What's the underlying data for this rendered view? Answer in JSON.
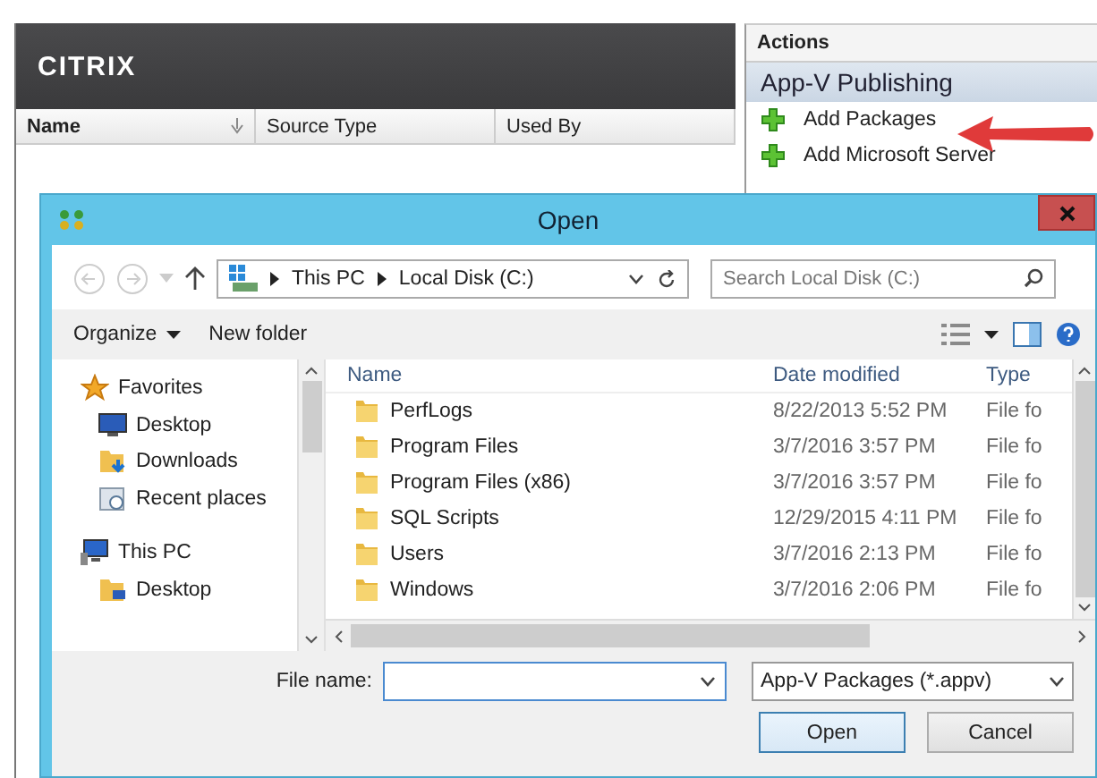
{
  "console": {
    "logo": "CITRIX",
    "columns": [
      {
        "label": "Name",
        "sorted": true
      },
      {
        "label": "Source Type",
        "sorted": false
      },
      {
        "label": "Used By",
        "sorted": false
      }
    ]
  },
  "actions": {
    "title": "Actions",
    "section": "App-V Publishing",
    "items": [
      {
        "label": "Add Packages",
        "pointed": true
      },
      {
        "label": "Add Microsoft Server",
        "pointed": false
      }
    ]
  },
  "dialog": {
    "title": "Open",
    "breadcrumb": [
      "This PC",
      "Local Disk (C:)"
    ],
    "search": {
      "placeholder": "Search Local Disk (C:)"
    },
    "toolbar": {
      "organize": "Organize",
      "new_folder": "New folder"
    },
    "nav": [
      {
        "label": "Favorites",
        "kind": "star",
        "children": [
          {
            "label": "Desktop",
            "kind": "desktop"
          },
          {
            "label": "Downloads",
            "kind": "downloads"
          },
          {
            "label": "Recent places",
            "kind": "recent"
          }
        ]
      },
      {
        "label": "This PC",
        "kind": "pc",
        "children": [
          {
            "label": "Desktop",
            "kind": "folder-desktop"
          }
        ]
      }
    ],
    "columns": [
      "Name",
      "Date modified",
      "Type"
    ],
    "files": [
      {
        "name": "PerfLogs",
        "date": "8/22/2013 5:52 PM",
        "type": "File fo"
      },
      {
        "name": "Program Files",
        "date": "3/7/2016 3:57 PM",
        "type": "File fo"
      },
      {
        "name": "Program Files (x86)",
        "date": "3/7/2016 3:57 PM",
        "type": "File fo"
      },
      {
        "name": "SQL Scripts",
        "date": "12/29/2015 4:11 PM",
        "type": "File fo"
      },
      {
        "name": "Users",
        "date": "3/7/2016 2:13 PM",
        "type": "File fo"
      },
      {
        "name": "Windows",
        "date": "3/7/2016 2:06 PM",
        "type": "File fo"
      }
    ],
    "file_name_label": "File name:",
    "filter": "App-V Packages (*.appv)",
    "buttons": [
      {
        "label": "Open",
        "default": true
      },
      {
        "label": "Cancel",
        "default": false
      }
    ]
  }
}
